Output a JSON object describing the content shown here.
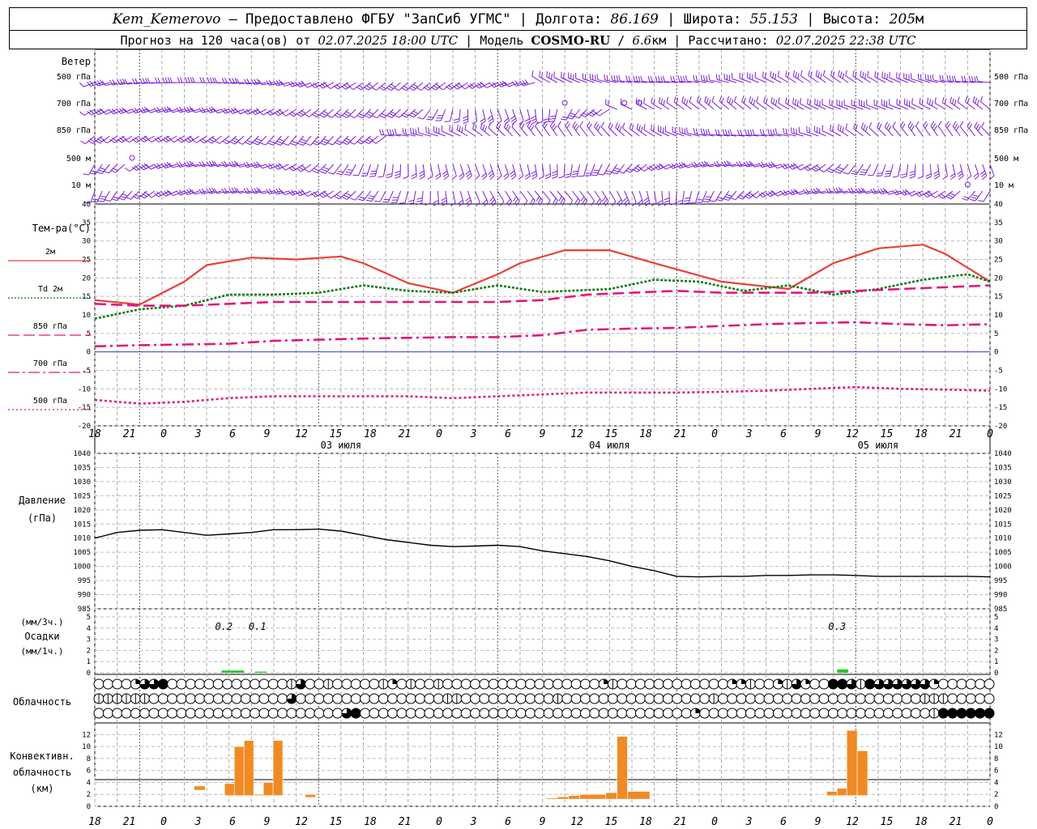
{
  "header": {
    "station": "Kem_Kemerovo",
    "dash": " — ",
    "provider": "Предоставлено ФГБУ \"ЗапСиб УГМС\"",
    "sep": " | ",
    "lon_label": "Долгота: ",
    "lon": "86.169",
    "lat_label": "Широта: ",
    "lat": "55.153",
    "alt_label": "Высота: ",
    "alt": "205",
    "alt_unit": "м",
    "forecast_label": "Прогноз на 120 часа(ов) от ",
    "forecast_time": "02.07.2025 18:00 UTC",
    "model_label": "Модель ",
    "model": "COSMO-RU",
    "slash": " / ",
    "res": "6.6",
    "res_unit": "км",
    "calc_label": "Рассчитано: ",
    "calc_time": "02.07.2025 22:38 UTC"
  },
  "wind_panel": {
    "title": "Ветер",
    "levels": [
      "500 гПа",
      "700 гПа",
      "850 гПа",
      "500 м",
      "10  м"
    ],
    "colors": {
      "barb": "#7b1fd6",
      "calm": "#7b1fd6"
    }
  },
  "hour_ticks": [
    "18",
    "21",
    "0",
    "3",
    "6",
    "9",
    "12",
    "15",
    "18",
    "21",
    "0",
    "3",
    "6",
    "9",
    "12",
    "15",
    "18",
    "21",
    "0",
    "3",
    "6",
    "9",
    "12",
    "15",
    "18",
    "21",
    "0"
  ],
  "dates": [
    "03 июля",
    "04 июля",
    "05 июля"
  ],
  "temp_panel": {
    "title": "Тем-ра(°C)",
    "legend": [
      {
        "label": "2м",
        "color": "#e8403a",
        "style": "solid"
      },
      {
        "label": "Td  2м",
        "color": "#127a12",
        "style": "dotted"
      },
      {
        "label": "850 гПа",
        "color": "#e0187c",
        "style": "dash"
      },
      {
        "label": "700 гПа",
        "color": "#e0187c",
        "style": "dashdot"
      },
      {
        "label": "500 гПа",
        "color": "#e0187c",
        "style": "dot"
      }
    ],
    "yticks": [
      "40",
      "35",
      "30",
      "25",
      "20",
      "15",
      "10",
      "5",
      "0",
      "-5",
      "-10",
      "-15",
      "-20"
    ]
  },
  "pressure_panel": {
    "title1": "Давление",
    "title2": "(гПа)",
    "yticks": [
      "1040",
      "1035",
      "1030",
      "1025",
      "1020",
      "1015",
      "1010",
      "1005",
      "1000",
      "995",
      "990",
      "985"
    ]
  },
  "precip_panel": {
    "title1": "(мм/3ч.)",
    "title2": "Осадки",
    "title3": "(мм/1ч.)",
    "yticks": [
      "5",
      "4",
      "3",
      "2",
      "1",
      "0"
    ],
    "annotations": [
      "0.2",
      "0.1",
      "0.3"
    ],
    "color": "#22cc22"
  },
  "cloud_panel": {
    "title": "Облачность"
  },
  "conv_panel": {
    "title1": "Конвективн.",
    "title2": "облачность",
    "title3": "(км)",
    "yticks": [
      "12",
      "10",
      "8",
      "6",
      "4",
      "2",
      "0"
    ],
    "color": "#f08a24"
  },
  "chart_data": {
    "type": "line",
    "x_hours_from_start": "0..120 (start 02.07.2025 18:00 UTC)",
    "temperature": {
      "ylim": [
        -20,
        40
      ],
      "series": [
        {
          "name": "2м",
          "x": [
            0,
            6,
            12,
            15,
            21,
            27,
            33,
            36,
            42,
            48,
            54,
            57,
            63,
            69,
            75,
            84,
            93,
            99,
            105,
            111,
            114,
            120
          ],
          "values": [
            14,
            12.8,
            19,
            23.5,
            25.5,
            25,
            25.8,
            24,
            18.6,
            16,
            21,
            24,
            27.5,
            27.5,
            24,
            19,
            17,
            24,
            28,
            29,
            26.5,
            19
          ]
        },
        {
          "name": "Td 2м",
          "x": [
            0,
            6,
            12,
            18,
            24,
            30,
            36,
            42,
            48,
            54,
            60,
            69,
            75,
            81,
            87,
            93,
            99,
            105,
            111,
            117,
            120
          ],
          "values": [
            9,
            11.5,
            12.5,
            15.5,
            15.5,
            16,
            18,
            16.5,
            16,
            18,
            16.2,
            17,
            19.5,
            19,
            16.5,
            18,
            15.5,
            17,
            19.5,
            21,
            19
          ]
        },
        {
          "name": "850 гПа",
          "x": [
            0,
            6,
            12,
            18,
            24,
            30,
            36,
            42,
            48,
            54,
            60,
            66,
            72,
            78,
            84,
            90,
            96,
            102,
            108,
            114,
            120
          ],
          "values": [
            13,
            12.5,
            12.5,
            13,
            13.5,
            13.5,
            13.5,
            13.5,
            13.5,
            13.5,
            14,
            15.5,
            16,
            16.5,
            16,
            16,
            16,
            16.5,
            17,
            17.5,
            18
          ]
        },
        {
          "name": "700 гПа",
          "x": [
            0,
            6,
            12,
            18,
            24,
            30,
            36,
            42,
            48,
            54,
            60,
            66,
            72,
            78,
            84,
            90,
            96,
            102,
            108,
            114,
            120
          ],
          "values": [
            1.5,
            1.8,
            2,
            2.2,
            3,
            3.3,
            3.6,
            3.8,
            4,
            4,
            4.5,
            6,
            6.3,
            6.5,
            7,
            7.5,
            7.8,
            8,
            7.5,
            7.2,
            7.5
          ]
        },
        {
          "name": "500 гПа",
          "x": [
            0,
            6,
            12,
            18,
            24,
            30,
            36,
            42,
            48,
            54,
            60,
            66,
            72,
            78,
            84,
            90,
            96,
            102,
            108,
            114,
            120
          ],
          "values": [
            -13,
            -14,
            -13.5,
            -12.5,
            -12,
            -12,
            -12,
            -12,
            -12.5,
            -12,
            -11.5,
            -11,
            -11,
            -11,
            -10.8,
            -10.5,
            -10,
            -9.5,
            -10,
            -10.2,
            -10.5
          ]
        }
      ]
    },
    "pressure": {
      "ylim": [
        985,
        1040
      ],
      "x": [
        0,
        3,
        6,
        9,
        12,
        15,
        18,
        21,
        24,
        27,
        30,
        33,
        36,
        39,
        42,
        45,
        48,
        51,
        54,
        57,
        60,
        63,
        66,
        69,
        72,
        75,
        78,
        81,
        84,
        87,
        90,
        93,
        96,
        99,
        102,
        105,
        108,
        111,
        114,
        117,
        120
      ],
      "values": [
        1010,
        1012,
        1012.8,
        1013,
        1012,
        1011,
        1011.5,
        1012,
        1013,
        1013,
        1013.2,
        1012.5,
        1011,
        1009.5,
        1008.5,
        1007.5,
        1007,
        1007.2,
        1007.5,
        1007,
        1005.5,
        1004.5,
        1003.5,
        1002,
        1000,
        998.5,
        996.5,
        996.3,
        996.5,
        996.5,
        996.8,
        996.8,
        997,
        997,
        996.8,
        996.5,
        996.5,
        996.5,
        996.5,
        996.5,
        996.3
      ]
    },
    "precipitation": {
      "ylim": [
        0,
        5
      ],
      "bars": [
        {
          "x": [
            17,
            20
          ],
          "values": [
            0.2,
            0.2
          ]
        },
        {
          "x": [
            21.5,
            23
          ],
          "values": [
            0.1,
            0.1
          ]
        },
        {
          "x": [
            99.5,
            101
          ],
          "values": [
            0.3,
            0.1
          ]
        }
      ]
    },
    "convective_cloud_km": {
      "ylim": [
        0,
        13
      ],
      "bars": [
        {
          "x0": 13.3,
          "x1": 14.8,
          "bottom": 2.7,
          "top": 3.4
        },
        {
          "x0": 17.4,
          "x1": 18.7,
          "bottom": 1.8,
          "top": 3.8
        },
        {
          "x0": 18.7,
          "x1": 20.0,
          "bottom": 1.8,
          "top": 10
        },
        {
          "x0": 20.0,
          "x1": 21.3,
          "bottom": 1.8,
          "top": 11
        },
        {
          "x0": 21.3,
          "x1": 22.6,
          "bottom": 1.8,
          "top": 2
        },
        {
          "x0": 22.6,
          "x1": 23.9,
          "bottom": 1.8,
          "top": 4
        },
        {
          "x0": 23.9,
          "x1": 25.2,
          "bottom": 1.8,
          "top": 11
        },
        {
          "x0": 28.2,
          "x1": 29.6,
          "bottom": 1.5,
          "top": 2
        },
        {
          "x0": 60.5,
          "x1": 62,
          "bottom": 1.2,
          "top": 1.4
        },
        {
          "x0": 62,
          "x1": 63.5,
          "bottom": 1.2,
          "top": 1.6
        },
        {
          "x0": 63.5,
          "x1": 65,
          "bottom": 1.2,
          "top": 1.8
        },
        {
          "x0": 65,
          "x1": 68.5,
          "bottom": 1.2,
          "top": 2
        },
        {
          "x0": 68.5,
          "x1": 70,
          "bottom": 1.2,
          "top": 2.3
        },
        {
          "x0": 70,
          "x1": 71.4,
          "bottom": 1.2,
          "top": 11.7
        },
        {
          "x0": 71.4,
          "x1": 74.4,
          "bottom": 1.2,
          "top": 2.5
        },
        {
          "x0": 98.1,
          "x1": 99.5,
          "bottom": 1.8,
          "top": 2.5
        },
        {
          "x0": 99.5,
          "x1": 100.8,
          "bottom": 1.8,
          "top": 3
        },
        {
          "x0": 100.8,
          "x1": 102.2,
          "bottom": 1.8,
          "top": 12.7
        },
        {
          "x0": 102.2,
          "x1": 103.6,
          "bottom": 1.8,
          "top": 9.3
        }
      ]
    },
    "cloud_cover_rows": {
      "legend_note": "row1 low, row2 middle, row3 high; code 0=clear,1=half-line,2=quarter,3=three-quarter,4=full",
      "row1": {
        "nonzero": {
          "4": 2,
          "5": 3,
          "6": 3,
          "7": 4,
          "21": 1,
          "22": 3,
          "25": 1,
          "31": 1,
          "32": 2,
          "34": 1,
          "37": 1,
          "55": 2,
          "56": 1,
          "69": 2,
          "70": 2,
          "71": 1,
          "74": 2,
          "75": 1,
          "76": 3,
          "77": 2,
          "80": 4,
          "81": 4,
          "82": 3,
          "83": 1,
          "84": 4,
          "85": 3,
          "86": 3,
          "87": 3,
          "88": 3,
          "89": 3,
          "90": 3,
          "91": 2
        }
      },
      "row2": {
        "nonzero": {
          "0": 1,
          "1": 1,
          "2": 1,
          "3": 1,
          "4": 1,
          "5": 1,
          "21": 3,
          "38": 1,
          "39": 1,
          "50": 1,
          "67": 1,
          "90": 1,
          "91": 1,
          "92": 1
        }
      },
      "row3": {
        "nonzero": {
          "27": 3,
          "28": 4,
          "65": 2,
          "91": 1,
          "92": 4,
          "93": 4,
          "94": 4,
          "95": 4,
          "96": 4,
          "97": 4
        }
      }
    },
    "wind_barbs": "per 1-hour step, 5 levels (see markup script)"
  }
}
